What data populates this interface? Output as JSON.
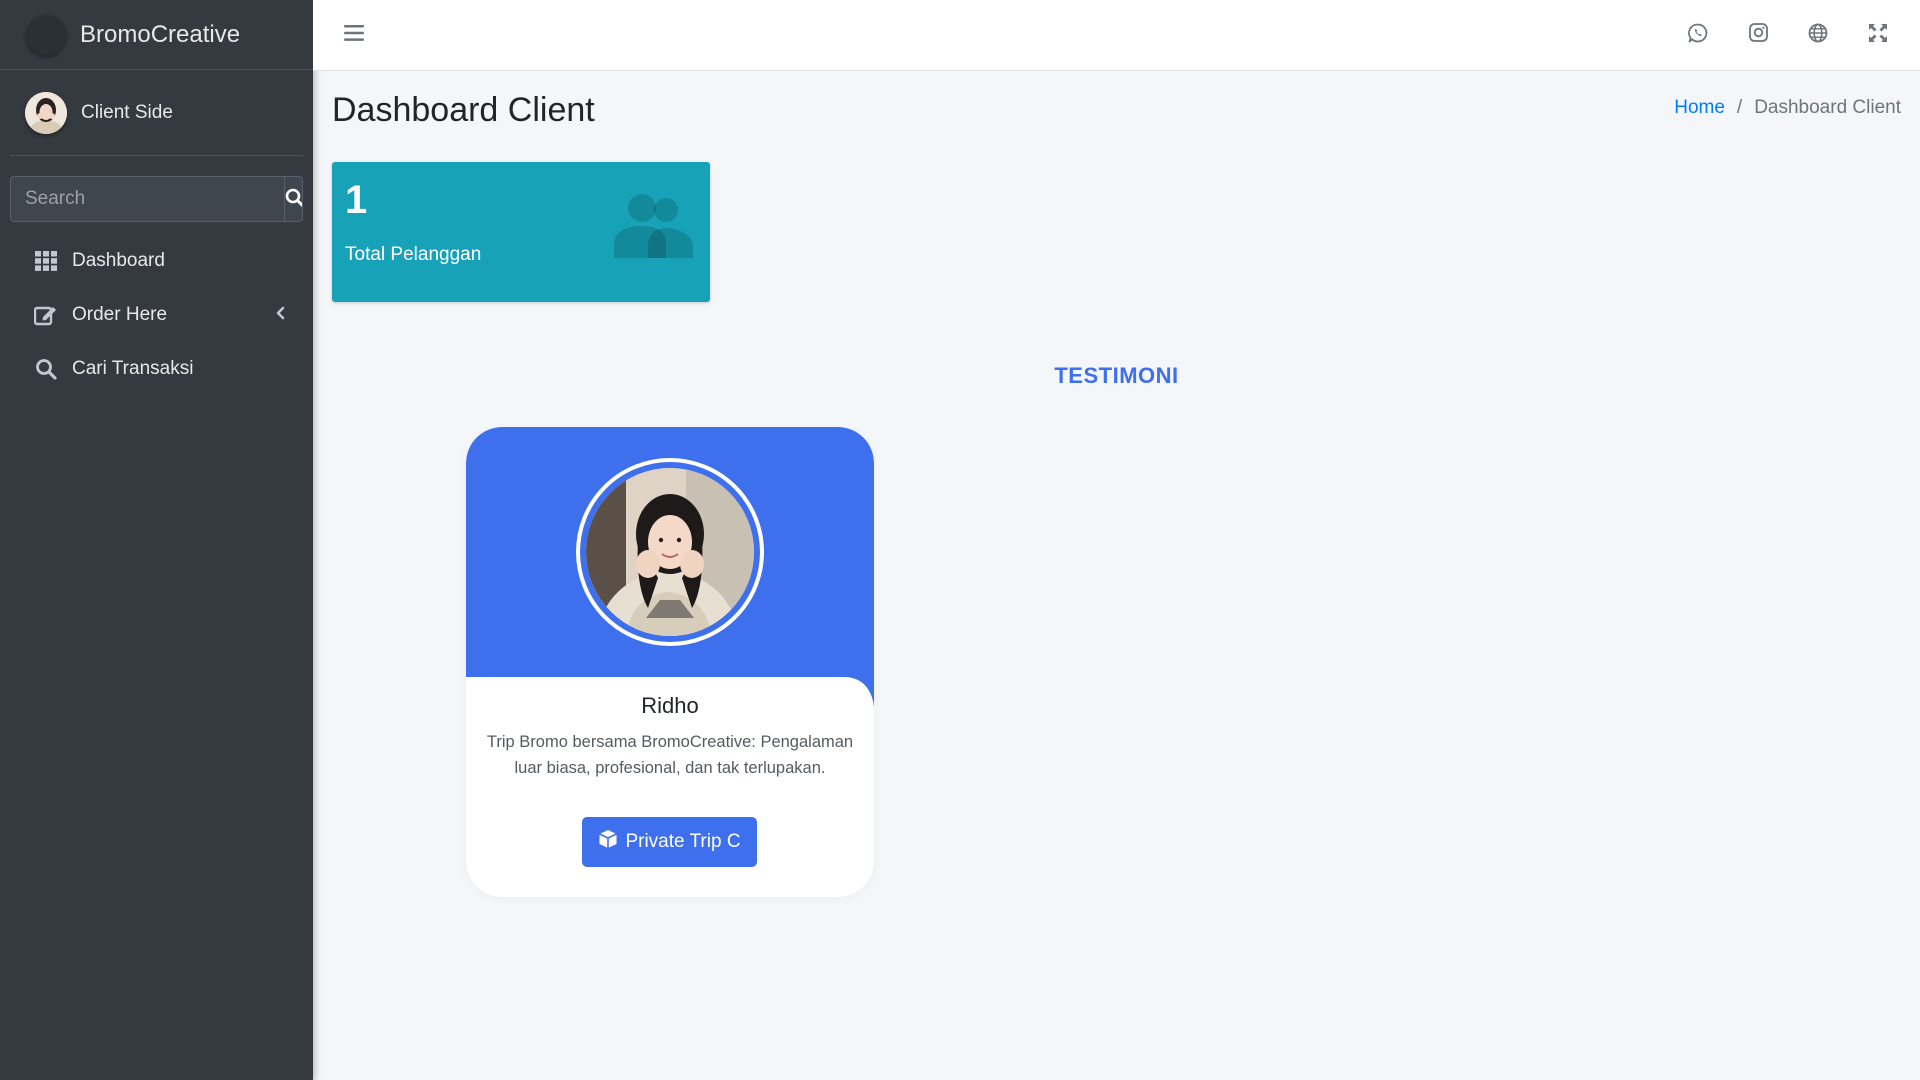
{
  "brand": {
    "name": "BromoCreative"
  },
  "user": {
    "name": "Client Side"
  },
  "search": {
    "placeholder": "Search"
  },
  "sidebar": {
    "items": [
      {
        "label": "Dashboard",
        "icon": "grid-icon"
      },
      {
        "label": "Order Here",
        "icon": "edit-icon"
      },
      {
        "label": "Cari Transaksi",
        "icon": "search-icon"
      }
    ]
  },
  "topbar": {
    "icons": [
      "whatsapp-icon",
      "instagram-icon",
      "globe-icon",
      "fullscreen-icon"
    ]
  },
  "page": {
    "title": "Dashboard Client",
    "breadcrumb": {
      "home": "Home",
      "separator": "/",
      "current": "Dashboard Client"
    }
  },
  "stats": {
    "total_pelanggan": {
      "value": "1",
      "label": "Total Pelanggan",
      "color": "#17a2b8"
    }
  },
  "testimoni": {
    "section_title": "TESTIMONI",
    "card": {
      "name": "Ridho",
      "text": "Trip Bromo bersama BromoCreative: Pengalaman luar biasa, profesional, dan tak terlupakan.",
      "button_label": "Private Trip C",
      "accent": "#3e6fec"
    }
  },
  "colors": {
    "sidebar": "#343a40",
    "link": "#007bff",
    "background": "#f4f6f9"
  }
}
